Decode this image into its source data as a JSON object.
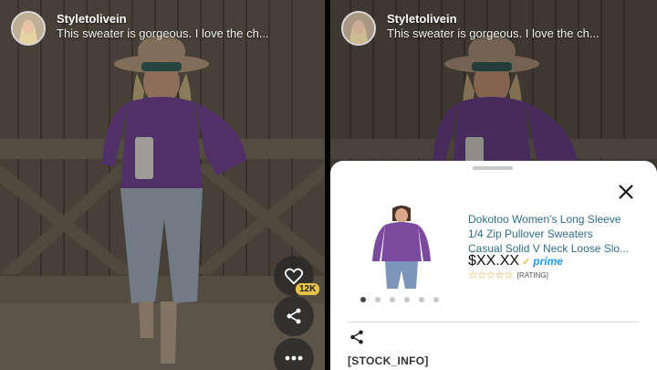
{
  "left_panel": {
    "username": "Styletolivein",
    "caption": "This sweater is gorgeous. I love the ch...",
    "like_count": "12K",
    "icons": {
      "avatar": "avatar-photo",
      "like": "heart-icon",
      "share": "share-icon",
      "more": "more-dots-icon"
    }
  },
  "right_panel": {
    "username": "Styletolivein",
    "caption": "This sweater is gorgeous. I love the ch...",
    "product_sheet": {
      "title_lines": [
        "Dokotoo Women's Long Sleeve",
        "1/4 Zip Pullover Sweaters",
        "Casual Solid V Neck Loose Slo..."
      ],
      "price": "$XX.XX",
      "prime_label": "prime",
      "rating_stars": "☆☆☆☆☆",
      "rating_label": "[RATING]",
      "carousel_dots": 6,
      "active_dot": 0,
      "stock_info": "[STOCK_INFO]",
      "icons": {
        "close": "close-icon",
        "share": "share-icon",
        "prime_check": "check-icon"
      }
    }
  },
  "colors": {
    "sweater": "#7b4a9e",
    "wood": "#706657",
    "title_link": "#2e6f88",
    "prime_blue": "#1a98ff",
    "badge": "#e7c34a"
  }
}
